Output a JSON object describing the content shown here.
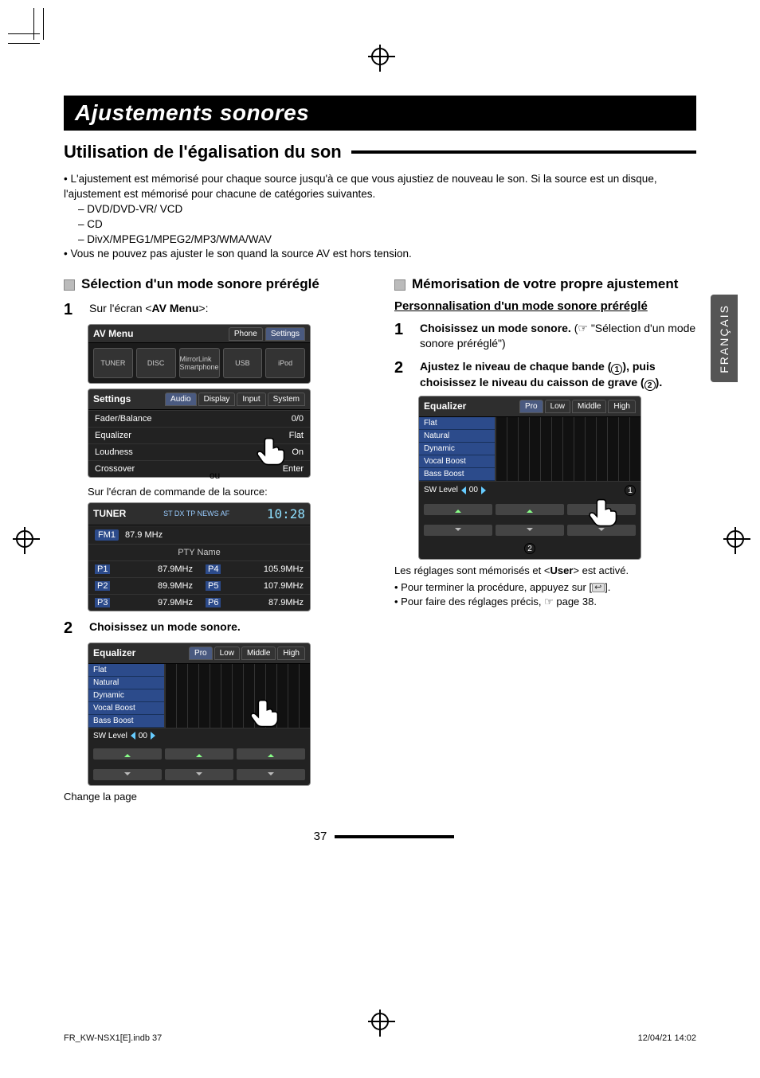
{
  "page_number": "37",
  "lang_tab": "FRANÇAIS",
  "footer_left": "FR_KW-NSX1[E].indb   37",
  "footer_right": "12/04/21   14:02",
  "title": "Ajustements sonores",
  "section_heading": "Utilisation de l'égalisation du son",
  "intro_bullet1": "L'ajustement est mémorisé pour chaque source jusqu'à ce que vous ajustiez de nouveau le son. Si la source est un disque, l'ajustement est mémorisé pour chacune de catégories suivantes.",
  "intro_sub1": "DVD/DVD-VR/ VCD",
  "intro_sub2": "CD",
  "intro_sub3": "DivX/MPEG1/MPEG2/MP3/WMA/WAV",
  "intro_bullet2": "Vous ne pouvez pas ajuster le son quand la source AV est hors tension.",
  "left": {
    "subhead": "Sélection d'un mode sonore préréglé",
    "step1_prefix": "Sur l'écran <",
    "step1_bold": "AV Menu",
    "step1_suffix": ">:",
    "avmenu": {
      "title": "AV Menu",
      "top_right1": "Phone",
      "top_right2": "Settings",
      "tiles": [
        "TUNER",
        "DISC",
        "MirrorLink Smartphone",
        "USB",
        "iPod"
      ]
    },
    "settings": {
      "title": "Settings",
      "tabs": [
        "Audio",
        "Display",
        "Input",
        "System"
      ],
      "rows": [
        {
          "k": "Fader/Balance",
          "v": "0/0"
        },
        {
          "k": "Equalizer",
          "v": "Flat"
        },
        {
          "k": "Loudness",
          "v": "On"
        },
        {
          "k": "Crossover",
          "v": "Enter"
        }
      ]
    },
    "ou": "ou",
    "caption2": "Sur l'écran de commande de la source:",
    "tuner": {
      "title": "TUNER",
      "band": "FM1",
      "freq": "87.9 MHz",
      "flags": "ST  DX  TP  NEWS  AF",
      "clock": "10:28",
      "pty": "PTY Name",
      "presets": [
        {
          "p": "P1",
          "f": "87.9MHz"
        },
        {
          "p": "P4",
          "f": "105.9MHz"
        },
        {
          "p": "P2",
          "f": "89.9MHz"
        },
        {
          "p": "P5",
          "f": "107.9MHz"
        },
        {
          "p": "P3",
          "f": "97.9MHz"
        },
        {
          "p": "P6",
          "f": "87.9MHz"
        }
      ]
    },
    "step2": "Choisissez un mode sonore.",
    "eq": {
      "title": "Equalizer",
      "tabs": [
        "Pro",
        "Low",
        "Middle",
        "High"
      ],
      "modes": [
        "Flat",
        "Natural",
        "Dynamic",
        "Vocal Boost",
        "Bass Boost"
      ],
      "sw_label": "SW Level",
      "sw_val": "00"
    },
    "change_page": "Change la page"
  },
  "right": {
    "subhead": "Mémorisation de votre propre ajustement",
    "under": "Personnalisation d'un mode sonore préréglé",
    "step1_bold": "Choisissez un mode sonore.",
    "step1_rest": " (☞ \"Sélection d'un mode sonore préréglé\")",
    "step2_a": "Ajustez le niveau de chaque bande (",
    "step2_b": "), puis choisissez le niveau du caisson de grave (",
    "step2_c": ").",
    "eq": {
      "title": "Equalizer",
      "tabs": [
        "Pro",
        "Low",
        "Middle",
        "High"
      ],
      "modes": [
        "Flat",
        "Natural",
        "Dynamic",
        "Vocal Boost",
        "Bass Boost"
      ],
      "sw_label": "SW Level",
      "sw_val": "00"
    },
    "after_a": "Les réglages sont mémorisés et <",
    "after_b": "User",
    "after_c": "> est activé.",
    "note1": "Pour terminer la procédure, appuyez sur [",
    "note1_end": "].",
    "note2": "Pour faire des réglages précis, ☞ page 38."
  }
}
